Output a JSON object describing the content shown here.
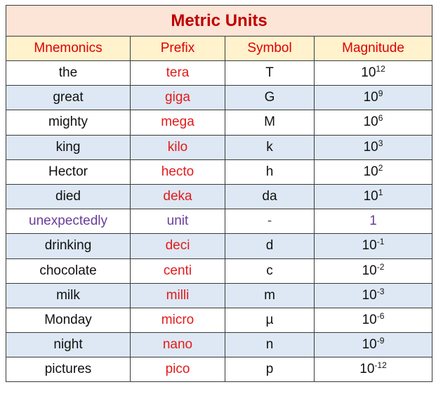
{
  "title": "Metric Units",
  "columns": [
    "Mnemonics",
    "Prefix",
    "Symbol",
    "Magnitude"
  ],
  "colors": {
    "title_bg": "#fce4d6",
    "title_text": "#c00000",
    "header_bg": "#fff2cc",
    "header_text": "#e00000",
    "prefix_text": "#e31a1a",
    "unit_row_text": "#6a3d9a",
    "shaded_row_bg": "#dde8f4"
  },
  "rows": [
    {
      "mnemonic": "the",
      "prefix": "tera",
      "symbol": "T",
      "base": "10",
      "exponent": "12"
    },
    {
      "mnemonic": "great",
      "prefix": "giga",
      "symbol": "G",
      "base": "10",
      "exponent": "9"
    },
    {
      "mnemonic": "mighty",
      "prefix": "mega",
      "symbol": "M",
      "base": "10",
      "exponent": "6"
    },
    {
      "mnemonic": "king",
      "prefix": "kilo",
      "symbol": "k",
      "base": "10",
      "exponent": "3"
    },
    {
      "mnemonic": "Hector",
      "prefix": "hecto",
      "symbol": "h",
      "base": "10",
      "exponent": "2"
    },
    {
      "mnemonic": "died",
      "prefix": "deka",
      "symbol": "da",
      "base": "10",
      "exponent": "1"
    },
    {
      "mnemonic": "unexpectedly",
      "prefix": "unit",
      "symbol": "-",
      "base": "1",
      "exponent": ""
    },
    {
      "mnemonic": "drinking",
      "prefix": "deci",
      "symbol": "d",
      "base": "10",
      "exponent": "-1"
    },
    {
      "mnemonic": "chocolate",
      "prefix": "centi",
      "symbol": "c",
      "base": "10",
      "exponent": "-2"
    },
    {
      "mnemonic": "milk",
      "prefix": "milli",
      "symbol": "m",
      "base": "10",
      "exponent": "-3"
    },
    {
      "mnemonic": "Monday",
      "prefix": "micro",
      "symbol": "µ",
      "base": "10",
      "exponent": "-6"
    },
    {
      "mnemonic": "night",
      "prefix": "nano",
      "symbol": "n",
      "base": "10",
      "exponent": "-9"
    },
    {
      "mnemonic": "pictures",
      "prefix": "pico",
      "symbol": "p",
      "base": "10",
      "exponent": "-12"
    }
  ]
}
